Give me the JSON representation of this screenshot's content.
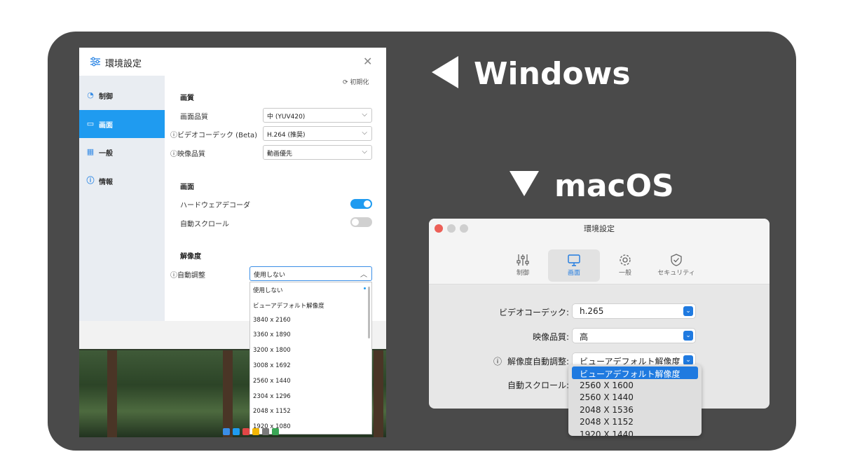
{
  "headings": {
    "windows": "Windows",
    "macos": "macOS"
  },
  "windows": {
    "title": "環境設定",
    "reset_label": "初期化",
    "sidebar": [
      {
        "label": "制御",
        "icon": "gauge-icon"
      },
      {
        "label": "画面",
        "icon": "monitor-icon"
      },
      {
        "label": "一般",
        "icon": "grid-icon"
      },
      {
        "label": "情報",
        "icon": "info-icon"
      }
    ],
    "sections": {
      "quality": "画質",
      "screen": "画面",
      "resolution": "解像度"
    },
    "rows": {
      "image_quality": {
        "label": "画面品質",
        "value": "中 (YUV420)"
      },
      "video_codec": {
        "label": "ビデオコーデック (Beta)",
        "value": "H.264 (推奨)"
      },
      "video_quality": {
        "label": "映像品質",
        "value": "動画優先"
      },
      "hw_decoder": {
        "label": "ハードウェアデコーダ",
        "on": true
      },
      "auto_scroll": {
        "label": "自動スクロール",
        "on": false
      },
      "auto_adjust": {
        "label": "自動調整",
        "value": "使用しない"
      }
    },
    "dropdown": [
      "使用しない",
      "ビューアデフォルト解像度",
      "3840 x 2160",
      "3360 x 1890",
      "3200 x 1800",
      "3008 x 1692",
      "2560 x 1440",
      "2304 x 1296",
      "2048 x 1152",
      "1920 x 1080"
    ]
  },
  "macos": {
    "title": "環境設定",
    "tabs": [
      {
        "label": "制御",
        "icon": "sliders-icon"
      },
      {
        "label": "画面",
        "icon": "display-icon"
      },
      {
        "label": "一般",
        "icon": "gear-icon"
      },
      {
        "label": "セキュリティ",
        "icon": "shield-check-icon"
      }
    ],
    "rows": {
      "video_codec": {
        "label": "ビデオコーデック:",
        "value": "h.265"
      },
      "video_quality": {
        "label": "映像品質:",
        "value": "高"
      },
      "auto_resolution": {
        "label": "解像度自動調整:",
        "value": "ビューアデフォルト解像度"
      },
      "auto_scroll": {
        "label": "自動スクロール:"
      }
    },
    "dropdown": [
      "ビューアデフォルト解像度",
      "2560 X 1600",
      "2560 X 1440",
      "2048 X 1536",
      "2048 X 1152",
      "1920 X 1440"
    ]
  },
  "colors": {
    "accent_windows": "#1f9bf0",
    "accent_macos": "#1f7ae0",
    "frame": "#4a4a4a"
  }
}
